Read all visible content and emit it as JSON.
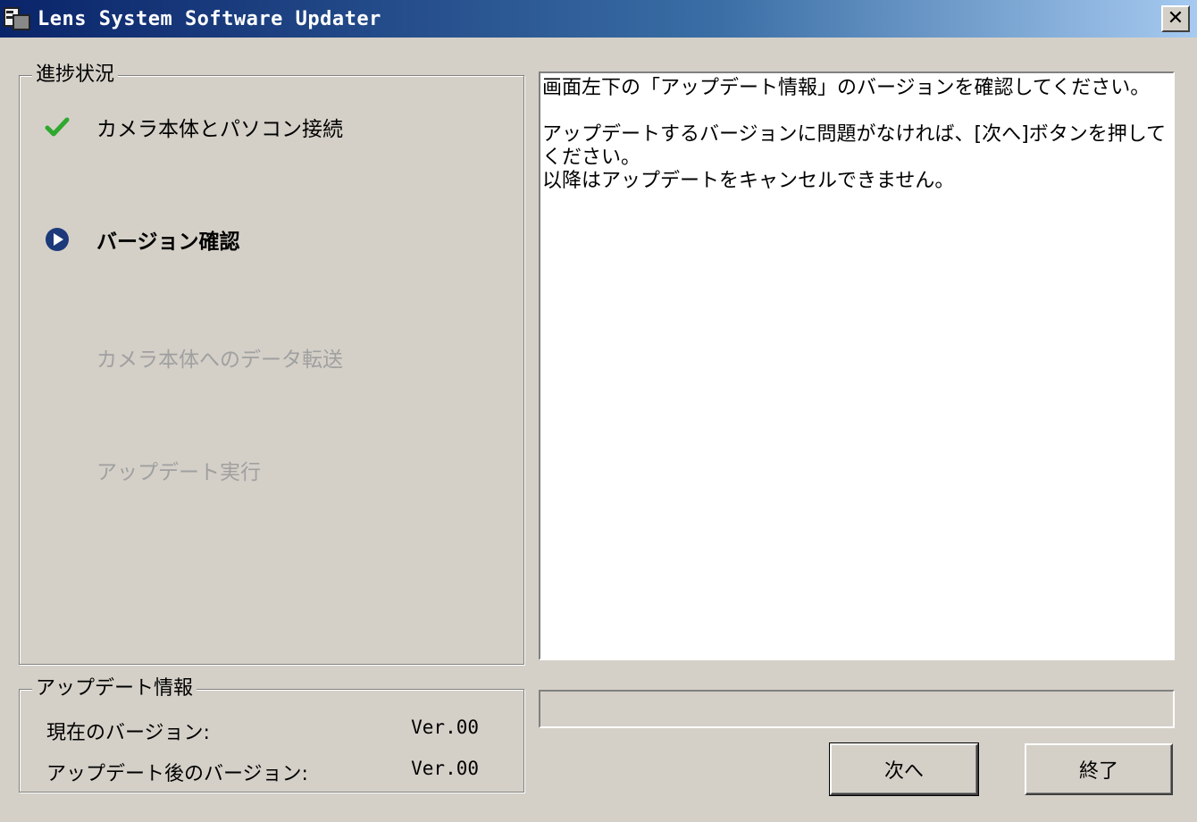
{
  "window": {
    "title": "Lens System Software Updater",
    "close_label": "✕"
  },
  "progress": {
    "legend": "進捗状況",
    "steps": [
      {
        "label": "カメラ本体とパソコン接続",
        "state": "done"
      },
      {
        "label": "バージョン確認",
        "state": "current"
      },
      {
        "label": "カメラ本体へのデータ転送",
        "state": "pending"
      },
      {
        "label": "アップデート実行",
        "state": "pending"
      }
    ]
  },
  "update_info": {
    "legend": "アップデート情報",
    "current_label": "現在のバージョン:",
    "current_value": "Ver.00",
    "after_label": "アップデート後のバージョン:",
    "after_value": "Ver.00"
  },
  "message": {
    "line1": "画面左下の「アップデート情報」のバージョンを確認してください。",
    "line2": "アップデートするバージョンに問題がなければ、[次へ]ボタンを押してください。",
    "line3": "以降はアップデートをキャンセルできません。"
  },
  "progress_bar": {
    "percent": 0
  },
  "buttons": {
    "next_label": "次へ",
    "exit_label": "終了"
  },
  "colors": {
    "check": "#2fa82f",
    "current_icon": "#1c3a7a",
    "pending_text": "#a0a0a0"
  }
}
